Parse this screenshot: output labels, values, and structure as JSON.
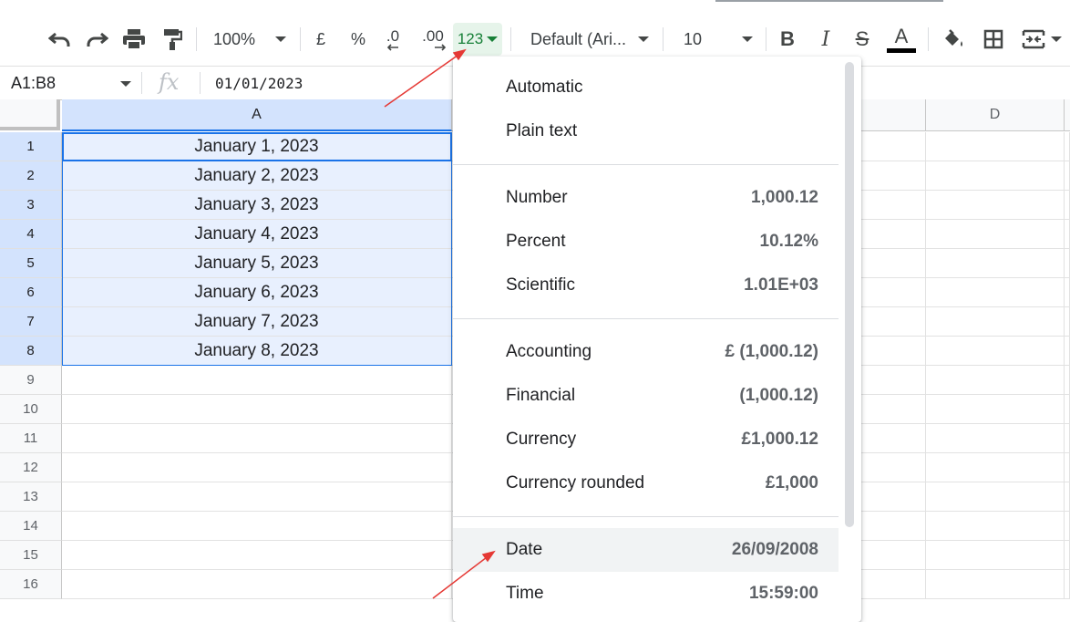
{
  "toolbar": {
    "zoom": "100%",
    "currency_symbol": "£",
    "percent_symbol": "%",
    "decrease_decimals": ".0",
    "increase_decimals": ".00",
    "more_formats": "123",
    "font_family": "Default (Ari...",
    "font_size": "10",
    "bold": "B",
    "italic": "I",
    "strikethrough": "S",
    "text_color": "A"
  },
  "formula_bar": {
    "name_box": "A1:B8",
    "fx": "fx",
    "value": "01/01/2023"
  },
  "columns": [
    "A",
    "D"
  ],
  "rows": [
    "1",
    "2",
    "3",
    "4",
    "5",
    "6",
    "7",
    "8",
    "9",
    "10",
    "11",
    "12",
    "13",
    "14",
    "15",
    "16"
  ],
  "cells": {
    "A1": "January 1, 2023",
    "A2": "January 2, 2023",
    "A3": "January 3, 2023",
    "A4": "January 4, 2023",
    "A5": "January 5, 2023",
    "A6": "January 6, 2023",
    "A7": "January 7, 2023",
    "A8": "January 8, 2023"
  },
  "format_menu": {
    "items": [
      {
        "label": "Automatic",
        "example": ""
      },
      {
        "label": "Plain text",
        "example": ""
      },
      {
        "label": "Number",
        "example": "1,000.12"
      },
      {
        "label": "Percent",
        "example": "10.12%"
      },
      {
        "label": "Scientific",
        "example": "1.01E+03"
      },
      {
        "label": "Accounting",
        "example": "£ (1,000.12)"
      },
      {
        "label": "Financial",
        "example": "(1,000.12)"
      },
      {
        "label": "Currency",
        "example": "£1,000.12"
      },
      {
        "label": "Currency rounded",
        "example": "£1,000"
      },
      {
        "label": "Date",
        "example": "26/09/2008"
      },
      {
        "label": "Time",
        "example": "15:59:00"
      }
    ]
  },
  "colors": {
    "selection_fill": "#e8f0fe",
    "selection_border": "#1a73e8",
    "format_button_bg": "#e6f4ea",
    "format_button_fg": "#188038",
    "annotation_arrow": "#e53935"
  }
}
